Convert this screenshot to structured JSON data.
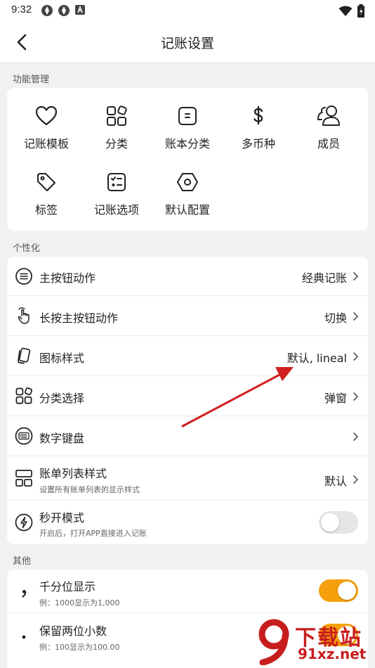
{
  "status_bar": {
    "time": "9:32",
    "left_icons": [
      "app-notification-icon",
      "app-notification-icon",
      "a-letter-icon"
    ],
    "right_icons": [
      "wifi-icon",
      "battery-charging-icon"
    ]
  },
  "header": {
    "title": "记账设置",
    "back_icon": "chevron-left-icon"
  },
  "features": {
    "section_label": "功能管理",
    "items": [
      {
        "label": "记账模板",
        "icon": "heart-icon"
      },
      {
        "label": "分类",
        "icon": "category-grid-icon"
      },
      {
        "label": "账本分类",
        "icon": "ledger-icon"
      },
      {
        "label": "多币种",
        "icon": "dollar-icon"
      },
      {
        "label": "成员",
        "icon": "members-icon"
      },
      {
        "label": "标签",
        "icon": "tag-icon"
      },
      {
        "label": "记账选项",
        "icon": "checklist-icon"
      },
      {
        "label": "默认配置",
        "icon": "hexagon-settings-icon"
      }
    ]
  },
  "personalize": {
    "section_label": "个性化",
    "rows": [
      {
        "title": "主按钮动作",
        "value": "经典记账",
        "icon": "menu-circle-icon",
        "chevron": true
      },
      {
        "title": "长按主按钮动作",
        "value": "切换",
        "icon": "long-press-icon",
        "chevron": true
      },
      {
        "title": "图标样式",
        "value": "默认, lineal",
        "icon": "icon-style-icon",
        "chevron": true
      },
      {
        "title": "分类选择",
        "value": "弹窗",
        "icon": "category-grid-icon",
        "chevron": true
      },
      {
        "title": "数字键盘",
        "value": "",
        "icon": "keyboard-icon",
        "chevron": true
      },
      {
        "title": "账单列表样式",
        "subtitle": "设置所有账单列表的显示样式",
        "value": "默认",
        "icon": "list-layout-icon",
        "chevron": true
      },
      {
        "title": "秒开模式",
        "subtitle": "开启后，打开APP直接进入记账",
        "icon": "lightning-icon",
        "toggle": false
      }
    ]
  },
  "others": {
    "section_label": "其他",
    "rows": [
      {
        "title": "千分位显示",
        "subtitle": "例：1000显示为1,000",
        "icon": "comma-icon",
        "toggle": true
      },
      {
        "title": "保留两位小数",
        "subtitle": "例：100显示为100.00",
        "icon": "dot-icon",
        "toggle": true
      }
    ]
  },
  "watermark": {
    "text": "下载站",
    "url": "91xz.net"
  },
  "colors": {
    "accent": "#f5a00c",
    "annotation_arrow": "#d11f1f",
    "background": "#f1f1f3",
    "card": "#ffffff"
  }
}
